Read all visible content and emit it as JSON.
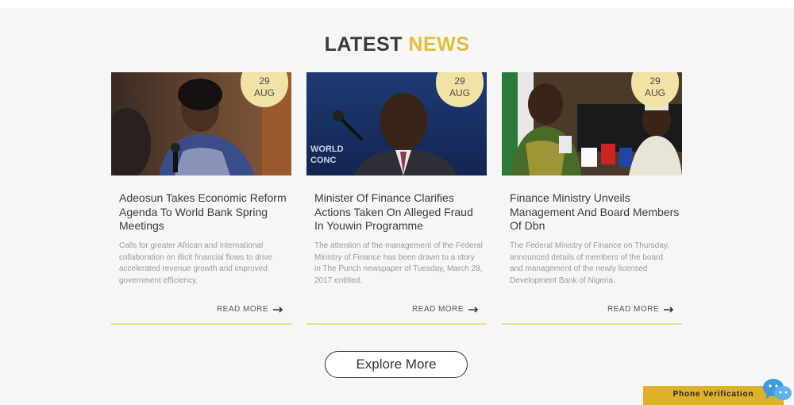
{
  "section": {
    "title_part1": "LATEST",
    "title_part2": "NEWS"
  },
  "articles": [
    {
      "day": "29",
      "month": "AUG",
      "title": "Adeosun Takes Economic Reform Agenda To World Bank Spring Meetings",
      "excerpt": "Calls for greater African and international collaboration on illicit financial flows to drive accelerated revenue growth and improved government efficiency.",
      "read_more": "READ MORE"
    },
    {
      "day": "29",
      "month": "AUG",
      "title": "Minister Of Finance Clarifies Actions Taken On Alleged Fraud In Youwin Programme",
      "excerpt": "The attention of the management of the Federal Ministry of Finance has been drawn to a story in The Punch newspaper of Tuesday, March 28, 2017 entitled.",
      "read_more": "READ MORE"
    },
    {
      "day": "29",
      "month": "AUG",
      "title": "Finance Ministry Unveils Management And Board Members Of Dbn",
      "excerpt": "The Federal Ministry of Finance on Thursday, announced details of members of the board and management of the newly licensed Development Bank of Nigeria.",
      "read_more": "READ MORE"
    }
  ],
  "explore_more": "Explore More",
  "phone_verification": "Phone Verification",
  "icons": {
    "arrow": "arrow-right-icon",
    "chat": "chat-bubbles-icon"
  },
  "colors": {
    "accent": "#e0bf3a",
    "badge": "#f1e2a6",
    "button": "#dfb12a"
  }
}
